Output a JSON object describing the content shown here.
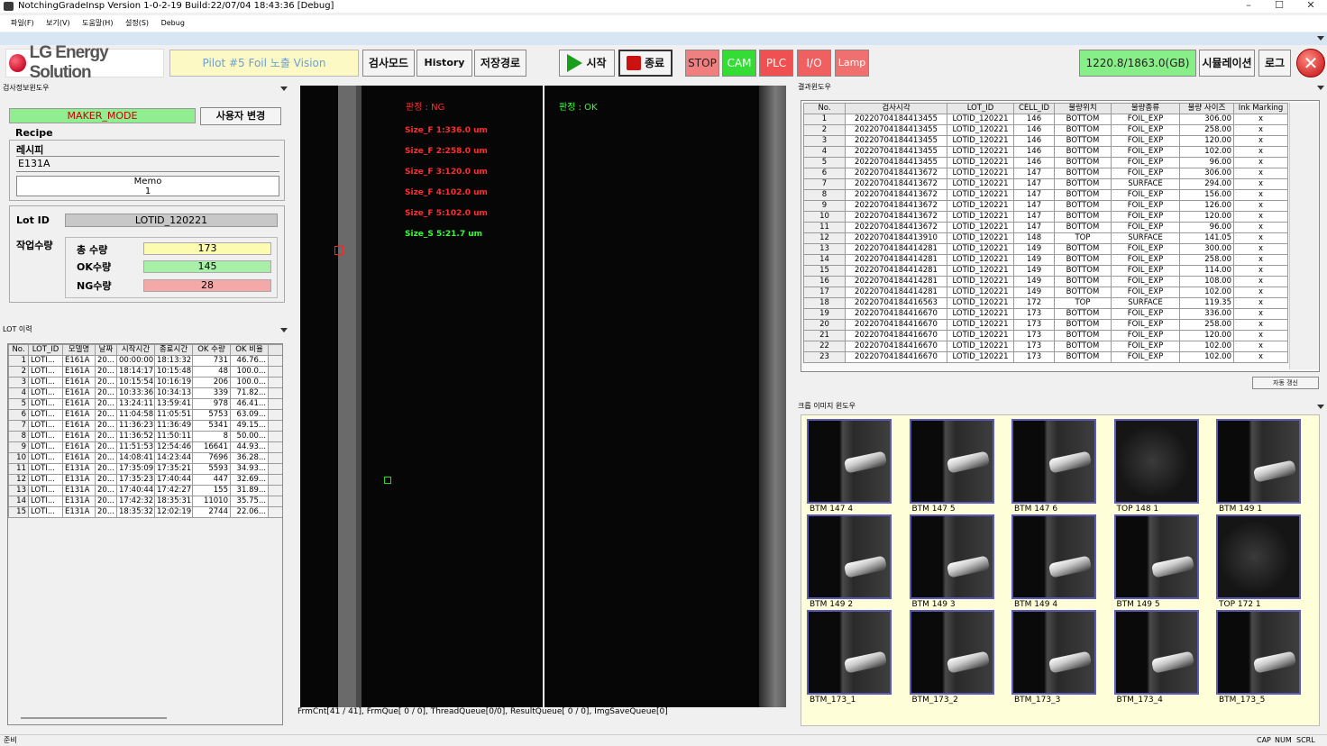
{
  "window": {
    "title": "NotchingGradeInsp Version 1-0-2-19 Build:22/07/04 18:43:36 [Debug]",
    "min": "–",
    "max": "☐",
    "close": "✕"
  },
  "menu": [
    "파일(F)",
    "보기(V)",
    "도움말(H)",
    "설정(S)",
    "Debug"
  ],
  "toolbar": {
    "logo": "LG Energy Solution",
    "pilot": "Pilot #5 Foil 노출 Vision",
    "inspect_mode": "검사모드",
    "history": "History",
    "save_path": "저장경로",
    "start": "시작",
    "end": "종료",
    "stop": "STOP",
    "cam": "CAM",
    "plc": "PLC",
    "io": "I/O",
    "lamp": "Lamp",
    "disk": "1220.8/1863.0(GB)",
    "simulation": "시뮬레이션",
    "log": "로그",
    "colors": {
      "stop": "#f08080",
      "cam": "#33dd33",
      "plc": "#f05050",
      "io": "#f06060",
      "lamp": "#f07070",
      "disk": "#88ee88",
      "start": "#1b9e1b",
      "end": "#cc1111"
    }
  },
  "info_panel": {
    "header": "검사정보윈도우",
    "mode": "MAKER_MODE",
    "user_change": "사용자 변경",
    "recipe_label": "Recipe",
    "recipe_sub": "레시피",
    "recipe_value": "E131A",
    "memo_label": "Memo",
    "memo_value": "1",
    "lot_label": "Lot ID",
    "lot_value": "LOTID_120221",
    "work_qty_label": "작업수량",
    "total_label": "총 수량",
    "total": "173",
    "ok_label": "OK수량",
    "ok": "145",
    "ng_label": "NG수량",
    "ng": "28"
  },
  "lot_history": {
    "header": "LOT 이력",
    "columns": [
      "No.",
      "LOT_ID",
      "모델명",
      "날짜",
      "시작시간",
      "종료시간",
      "OK 수량",
      "OK 비율"
    ],
    "rows": [
      [
        "1",
        "LOTI...",
        "E161A",
        "20...",
        "00:00:00",
        "18:13:32",
        "731",
        "46.76..."
      ],
      [
        "2",
        "LOTI...",
        "E161A",
        "20...",
        "18:14:17",
        "10:15:48",
        "48",
        "100.0..."
      ],
      [
        "3",
        "LOTI...",
        "E161A",
        "20...",
        "10:15:54",
        "10:16:19",
        "206",
        "100.0..."
      ],
      [
        "4",
        "LOTI...",
        "E161A",
        "20...",
        "10:33:36",
        "10:34:13",
        "339",
        "71.82..."
      ],
      [
        "5",
        "LOTI...",
        "E161A",
        "20...",
        "13:24:11",
        "13:59:41",
        "978",
        "46.41..."
      ],
      [
        "6",
        "LOTI...",
        "E161A",
        "20...",
        "11:04:58",
        "11:05:51",
        "5753",
        "63.09..."
      ],
      [
        "7",
        "LOTI...",
        "E161A",
        "20...",
        "11:36:23",
        "11:36:49",
        "5341",
        "49.15..."
      ],
      [
        "8",
        "LOTI...",
        "E161A",
        "20...",
        "11:36:52",
        "11:50:11",
        "8",
        "50.00..."
      ],
      [
        "9",
        "LOTI...",
        "E161A",
        "20...",
        "11:51:53",
        "12:54:46",
        "16641",
        "44.93..."
      ],
      [
        "10",
        "LOTI...",
        "E161A",
        "20...",
        "14:08:41",
        "14:23:44",
        "7696",
        "36.28..."
      ],
      [
        "11",
        "LOTI...",
        "E131A",
        "20...",
        "17:35:09",
        "17:35:21",
        "5593",
        "34.93..."
      ],
      [
        "12",
        "LOTI...",
        "E131A",
        "20...",
        "17:35:23",
        "17:40:44",
        "447",
        "32.69..."
      ],
      [
        "13",
        "LOTI...",
        "E131A",
        "20...",
        "17:40:44",
        "17:42:27",
        "155",
        "31.89..."
      ],
      [
        "14",
        "LOTI...",
        "E131A",
        "20...",
        "17:42:32",
        "18:35:31",
        "11010",
        "35.75..."
      ],
      [
        "15",
        "LOTI...",
        "E131A",
        "20...",
        "18:35:32",
        "12:02:19",
        "2744",
        "22.06..."
      ]
    ]
  },
  "viewer": {
    "left_judge": "판정 : NG",
    "sizes": [
      "Size_F 1:336.0 um",
      "Size_F 2:258.0 um",
      "Size_F 3:120.0 um",
      "Size_F 4:102.0 um",
      "Size_F 5:102.0 um"
    ],
    "size_s": "Size_S 5:21.7 um",
    "right_judge": "판정 : OK",
    "status": "FrmCnt[41 / 41], FrmQue[ 0 / 0], ThreadQueue[0/0], ResultQueue[ 0 / 0], ImgSaveQueue[0]"
  },
  "results": {
    "header": "결과윈도우",
    "columns": [
      "No.",
      "검사시각",
      "LOT_ID",
      "CELL_ID",
      "불량위치",
      "불량종류",
      "불량 사이즈",
      "Ink Marking"
    ],
    "rows": [
      [
        "1",
        "20220704184413455",
        "LOTID_120221",
        "146",
        "BOTTOM",
        "FOIL_EXP",
        "306.00",
        "x"
      ],
      [
        "2",
        "20220704184413455",
        "LOTID_120221",
        "146",
        "BOTTOM",
        "FOIL_EXP",
        "258.00",
        "x"
      ],
      [
        "3",
        "20220704184413455",
        "LOTID_120221",
        "146",
        "BOTTOM",
        "FOIL_EXP",
        "120.00",
        "x"
      ],
      [
        "4",
        "20220704184413455",
        "LOTID_120221",
        "146",
        "BOTTOM",
        "FOIL_EXP",
        "102.00",
        "x"
      ],
      [
        "5",
        "20220704184413455",
        "LOTID_120221",
        "146",
        "BOTTOM",
        "FOIL_EXP",
        "96.00",
        "x"
      ],
      [
        "6",
        "20220704184413672",
        "LOTID_120221",
        "147",
        "BOTTOM",
        "FOIL_EXP",
        "306.00",
        "x"
      ],
      [
        "7",
        "20220704184413672",
        "LOTID_120221",
        "147",
        "BOTTOM",
        "SURFACE",
        "294.00",
        "x"
      ],
      [
        "8",
        "20220704184413672",
        "LOTID_120221",
        "147",
        "BOTTOM",
        "FOIL_EXP",
        "156.00",
        "x"
      ],
      [
        "9",
        "20220704184413672",
        "LOTID_120221",
        "147",
        "BOTTOM",
        "FOIL_EXP",
        "126.00",
        "x"
      ],
      [
        "10",
        "20220704184413672",
        "LOTID_120221",
        "147",
        "BOTTOM",
        "FOIL_EXP",
        "120.00",
        "x"
      ],
      [
        "11",
        "20220704184413672",
        "LOTID_120221",
        "147",
        "BOTTOM",
        "FOIL_EXP",
        "96.00",
        "x"
      ],
      [
        "12",
        "20220704184413910",
        "LOTID_120221",
        "148",
        "TOP",
        "SURFACE",
        "141.05",
        "x"
      ],
      [
        "13",
        "20220704184414281",
        "LOTID_120221",
        "149",
        "BOTTOM",
        "FOIL_EXP",
        "300.00",
        "x"
      ],
      [
        "14",
        "20220704184414281",
        "LOTID_120221",
        "149",
        "BOTTOM",
        "FOIL_EXP",
        "258.00",
        "x"
      ],
      [
        "15",
        "20220704184414281",
        "LOTID_120221",
        "149",
        "BOTTOM",
        "FOIL_EXP",
        "114.00",
        "x"
      ],
      [
        "16",
        "20220704184414281",
        "LOTID_120221",
        "149",
        "BOTTOM",
        "FOIL_EXP",
        "108.00",
        "x"
      ],
      [
        "17",
        "20220704184414281",
        "LOTID_120221",
        "149",
        "BOTTOM",
        "FOIL_EXP",
        "102.00",
        "x"
      ],
      [
        "18",
        "20220704184416563",
        "LOTID_120221",
        "172",
        "TOP",
        "SURFACE",
        "119.35",
        "x"
      ],
      [
        "19",
        "20220704184416670",
        "LOTID_120221",
        "173",
        "BOTTOM",
        "FOIL_EXP",
        "336.00",
        "x"
      ],
      [
        "20",
        "20220704184416670",
        "LOTID_120221",
        "173",
        "BOTTOM",
        "FOIL_EXP",
        "258.00",
        "x"
      ],
      [
        "21",
        "20220704184416670",
        "LOTID_120221",
        "173",
        "BOTTOM",
        "FOIL_EXP",
        "120.00",
        "x"
      ],
      [
        "22",
        "20220704184416670",
        "LOTID_120221",
        "173",
        "BOTTOM",
        "FOIL_EXP",
        "102.00",
        "x"
      ],
      [
        "23",
        "20220704184416670",
        "LOTID_120221",
        "173",
        "BOTTOM",
        "FOIL_EXP",
        "102.00",
        "x"
      ]
    ],
    "auto_refresh": "자동 갱신"
  },
  "crops": {
    "header": "크롭 이미지 윈도우",
    "items": [
      "BTM 147 4",
      "BTM 147 5",
      "BTM 147 6",
      "TOP 148 1",
      "BTM 149 1",
      "BTM 149 2",
      "BTM 149 3",
      "BTM 149 4",
      "BTM 149 5",
      "TOP 172 1",
      "BTM_173_1",
      "BTM_173_2",
      "BTM_173_3",
      "BTM_173_4",
      "BTM_173_5"
    ]
  },
  "statusbar": {
    "left": "준비",
    "caps": "CAP",
    "num": "NUM",
    "scrl": "SCRL"
  }
}
